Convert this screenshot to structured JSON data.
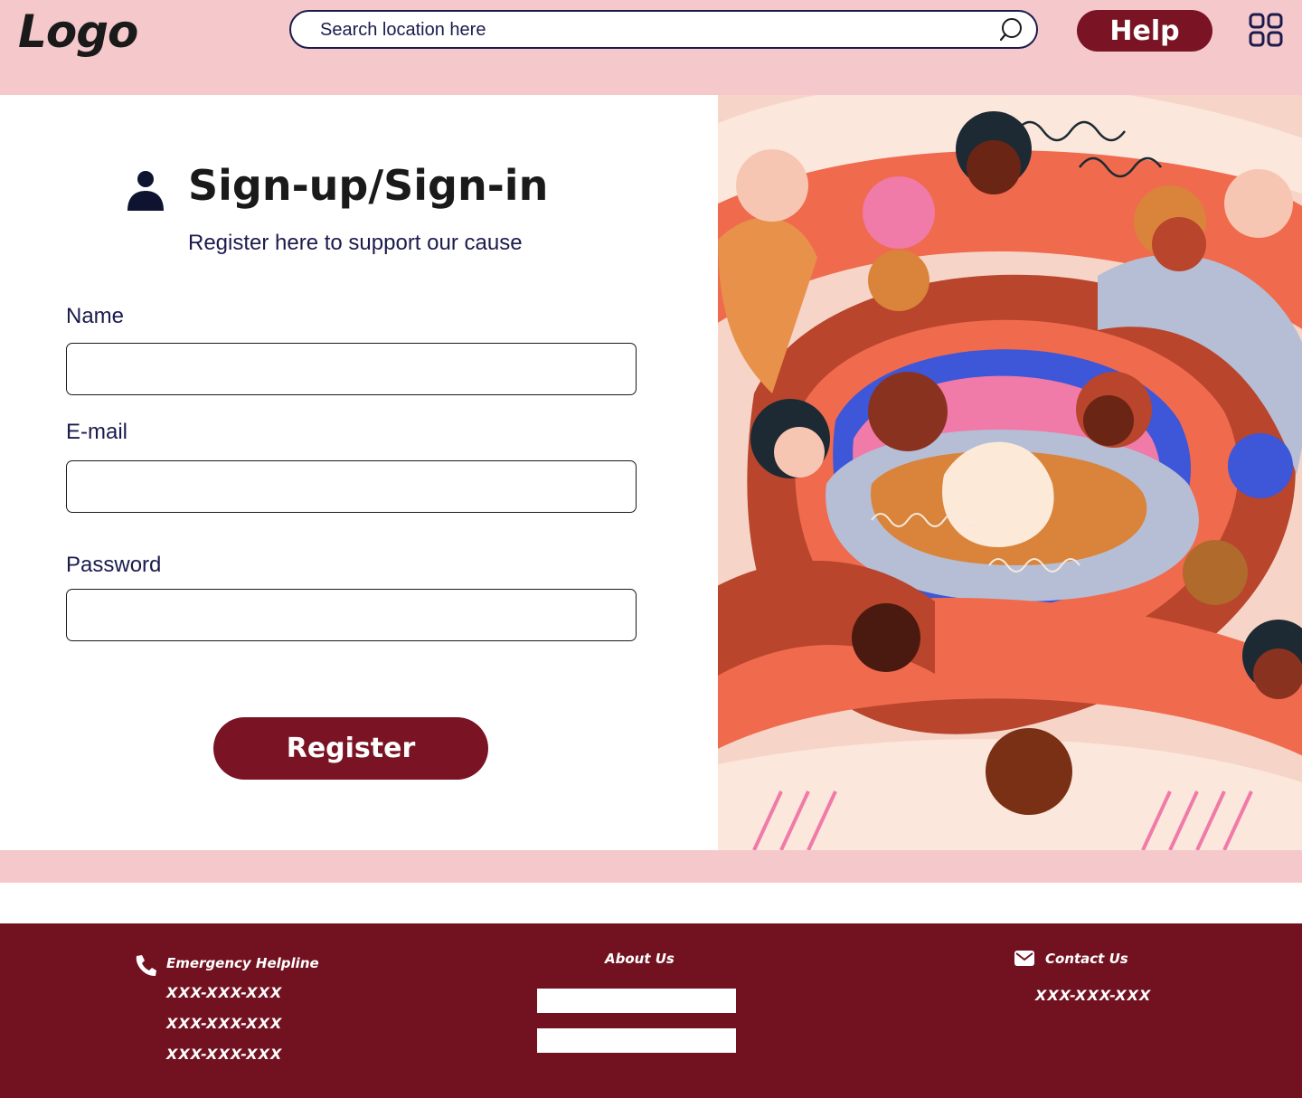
{
  "header": {
    "logo": "Logo",
    "search_placeholder": "Search location here",
    "help_label": "Help"
  },
  "form": {
    "title": "Sign-up/Sign-in",
    "subtitle": "Register here to support our cause",
    "fields": [
      {
        "label": "Name",
        "value": ""
      },
      {
        "label": "E-mail",
        "value": ""
      },
      {
        "label": "Password",
        "value": ""
      }
    ],
    "submit_label": "Register"
  },
  "footer": {
    "helpline": {
      "heading": "Emergency Helpline",
      "numbers": [
        "XXX-XXX-XXX",
        "XXX-XXX-XXX",
        "XXX-XXX-XXX"
      ]
    },
    "about": {
      "heading": "About Us"
    },
    "contact": {
      "heading": "Contact Us",
      "number": "XXX-XXX-XXX"
    }
  },
  "colors": {
    "header_bg": "#f5c9cb",
    "primary": "#7a1424",
    "footer_bg": "#721221",
    "text_navy": "#1b1b4d"
  },
  "icons": [
    "search-icon",
    "apps-grid-icon",
    "person-icon",
    "phone-icon",
    "mail-icon"
  ]
}
